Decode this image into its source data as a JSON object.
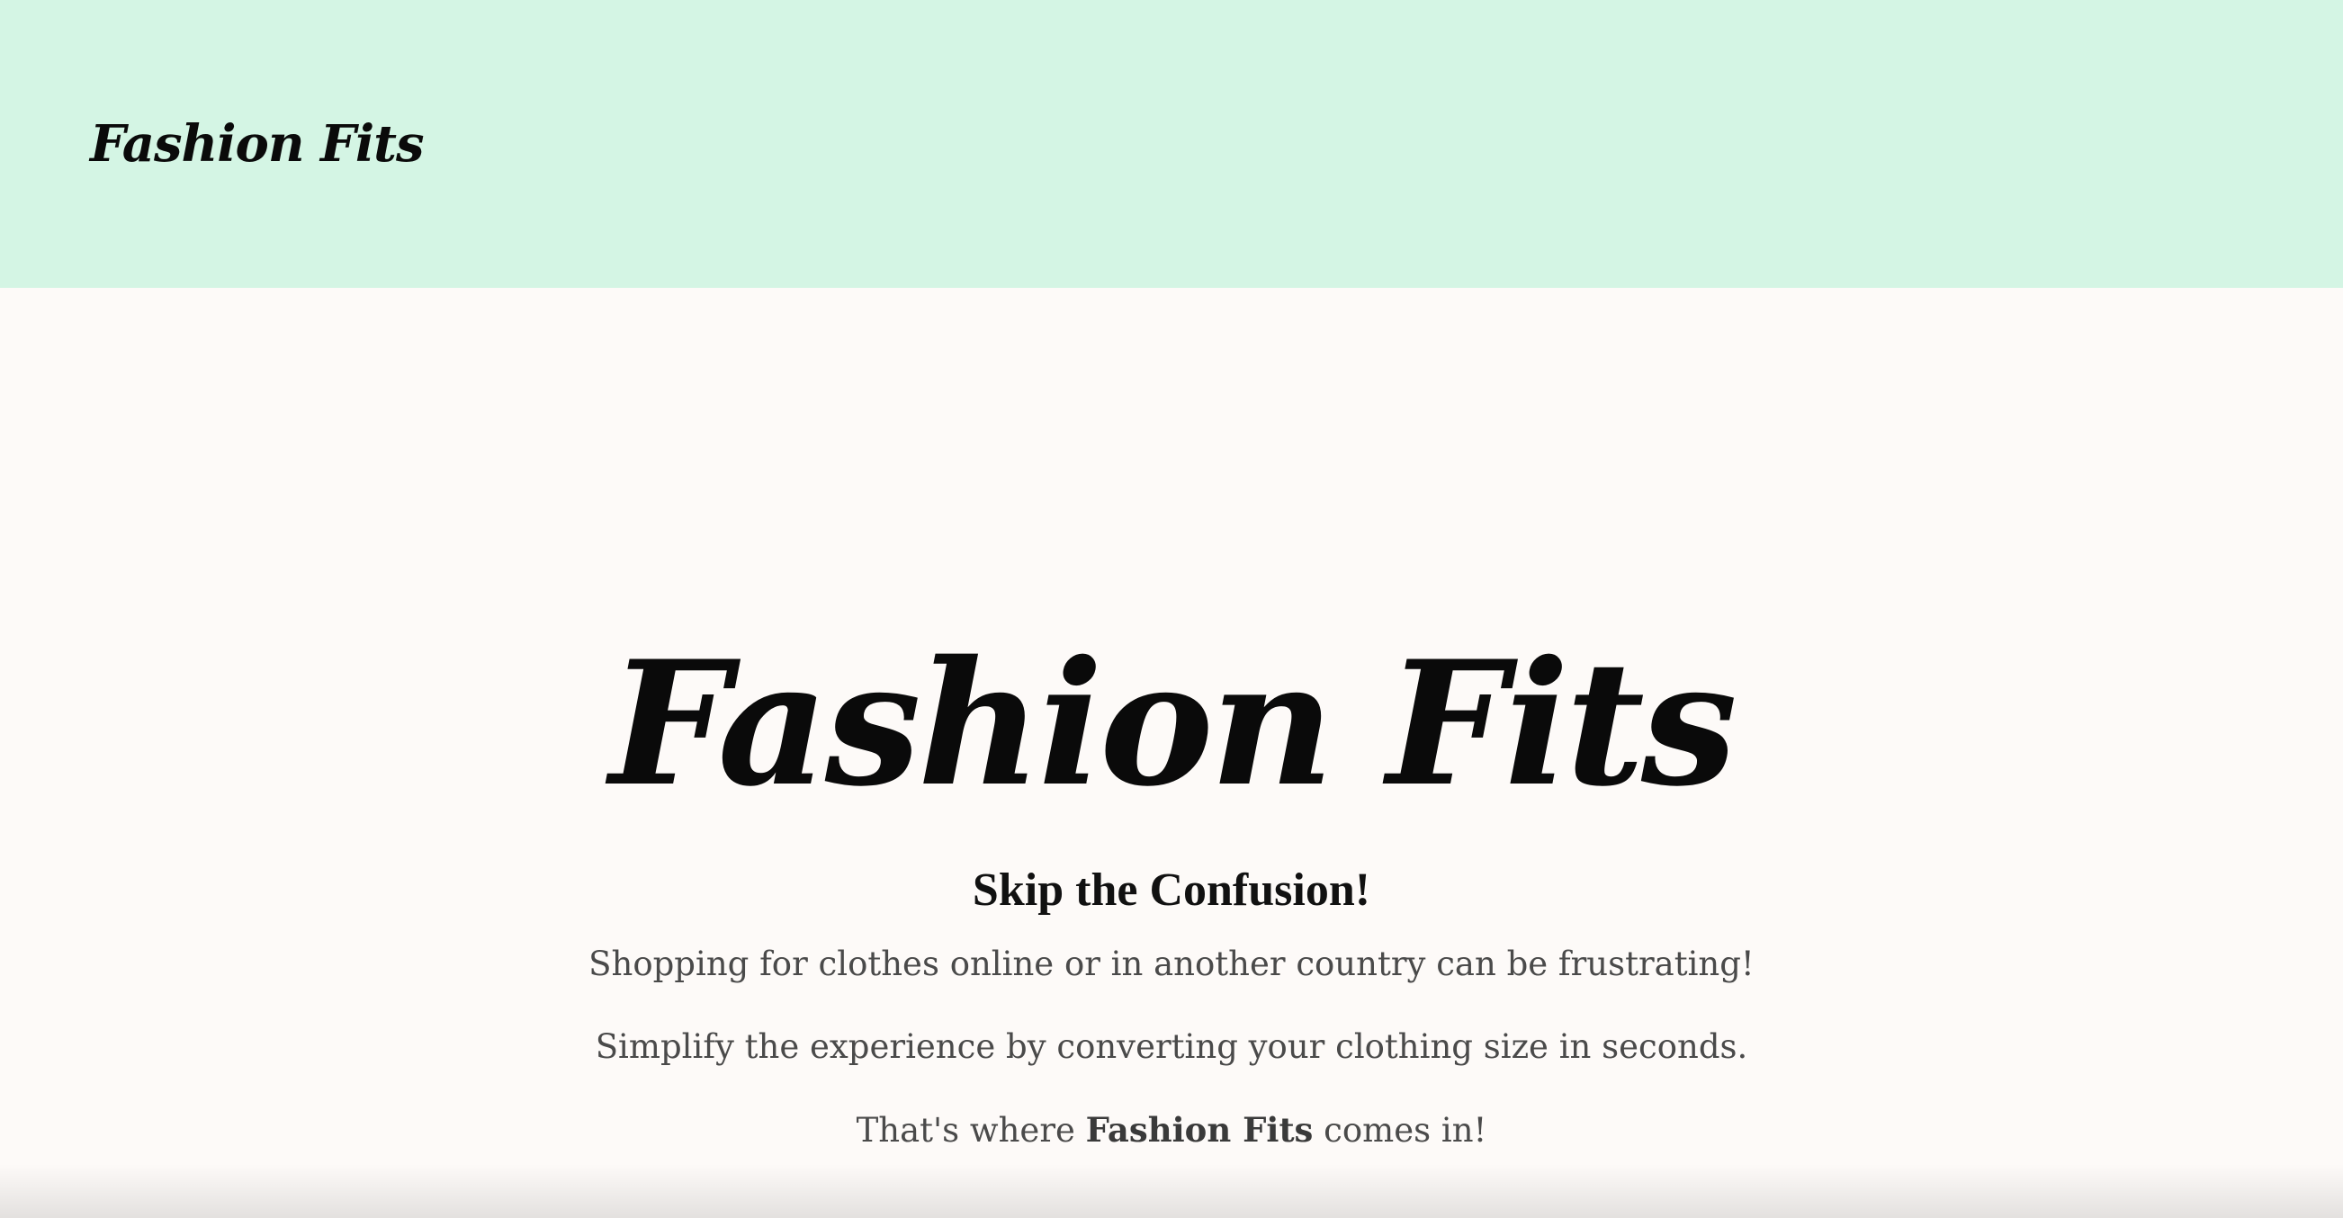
{
  "header": {
    "logo_text": "Fashion Fits"
  },
  "hero": {
    "title": "Fashion Fits"
  },
  "intro": {
    "heading": "Skip the Confusion!",
    "paragraph_1": "Shopping for clothes online or in another country can be frustrating!",
    "paragraph_2": "Simplify the experience by converting your clothing size in seconds.",
    "paragraph_3_prefix": "That's where ",
    "paragraph_3_brand": "Fashion Fits",
    "paragraph_3_suffix": " comes in!"
  },
  "colors": {
    "header_background": "#d4f5e4",
    "page_background": "#fdfaf8",
    "title_color": "#0a0a0a",
    "body_text_color": "#4a4a4a"
  }
}
